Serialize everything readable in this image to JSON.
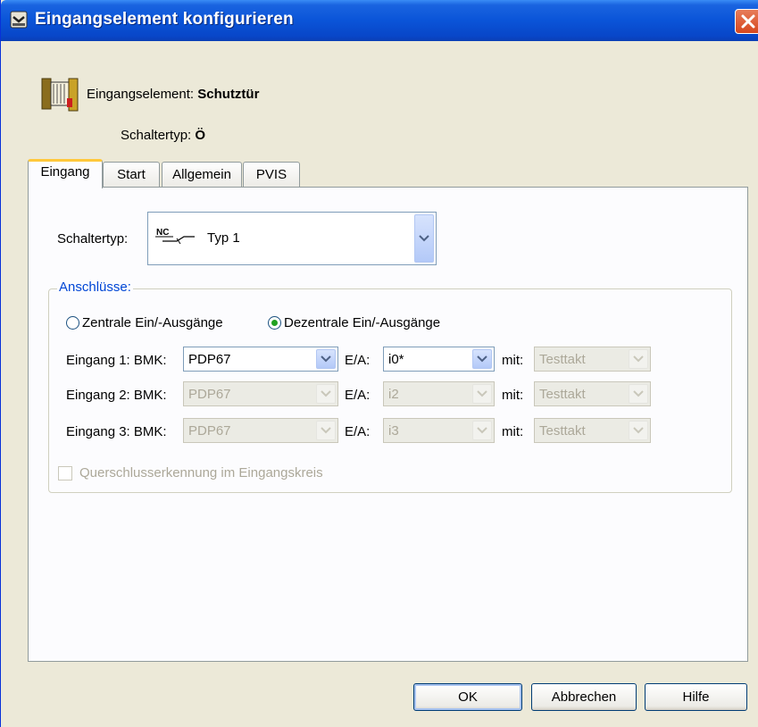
{
  "window": {
    "title": "Eingangselement konfigurieren",
    "title_icon": "dialog-app-icon",
    "close_icon": "close-icon"
  },
  "header": {
    "element_label": "Eingangselement:",
    "element_value": "Schutztür",
    "switch_type_label": "Schaltertyp:",
    "switch_type_value": "Ö",
    "icon": "safety-door-icon"
  },
  "tabs": [
    {
      "label": "Eingang",
      "active": true
    },
    {
      "label": "Start",
      "active": false
    },
    {
      "label": "Allgemein",
      "active": false
    },
    {
      "label": "PVIS",
      "active": false
    }
  ],
  "eingang": {
    "switch_type_label": "Schaltertyp:",
    "switch_type_symbol": "NC",
    "switch_type_value": "Typ 1",
    "connections_legend": "Anschlüsse:",
    "radio_central": "Zentrale Ein/-Ausgänge",
    "radio_decentral": "Dezentrale Ein/-Ausgänge",
    "selected_radio": "decentral",
    "bmk_suffix": "BMK:",
    "ea_label": "E/A:",
    "mit_label": "mit:",
    "rows": [
      {
        "label": "Eingang 1:",
        "bmk": "PDP67",
        "ea": "i0*",
        "mit": "Testtakt",
        "enabled": true
      },
      {
        "label": "Eingang 2:",
        "bmk": "PDP67",
        "ea": "i2",
        "mit": "Testtakt",
        "enabled": false
      },
      {
        "label": "Eingang 3:",
        "bmk": "PDP67",
        "ea": "i3",
        "mit": "Testtakt",
        "enabled": false
      }
    ],
    "cross_circuit_label": "Querschlusserkennung im Eingangskreis"
  },
  "buttons": {
    "ok": "OK",
    "cancel": "Abbrechen",
    "help": "Hilfe"
  },
  "colors": {
    "titlebar": "#0a54d8",
    "active_tab_highlight": "#ffc83c",
    "legend_text": "#0046d5",
    "radio_selected": "#21a121"
  }
}
